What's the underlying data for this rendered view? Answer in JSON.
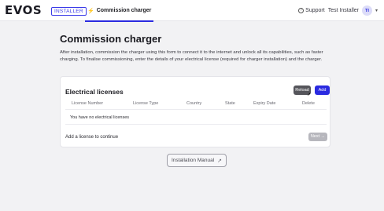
{
  "header": {
    "logo": "EVOS",
    "badge": "INSTALLER",
    "tab_icon": "⚡",
    "tab_label": "Commission charger",
    "support_label": "Support",
    "user_name": "Test Installer",
    "avatar_initials": "TI"
  },
  "main": {
    "title": "Commission charger",
    "description": "After installation, commission the charger using this form to connect it to the internet and unlock all its capabilities, such as faster charging. To finalise commissioning, enter the details of your electrical license (required for charger installation) and the charger."
  },
  "licenses": {
    "title": "Electrical licenses",
    "reload_label": "Reload",
    "add_label": "Add",
    "columns": [
      "License Number",
      "License Type",
      "Country",
      "State",
      "Expiry Date",
      "Delete"
    ],
    "empty_message": "You have no electrical licenses",
    "footer_message": "Add a license to continue",
    "next_label": "Next →"
  },
  "manual": {
    "label": "Installation Manual",
    "icon": "external-link-icon"
  },
  "colors": {
    "accent": "#2a2ae0",
    "reload_bg": "#55555b",
    "next_disabled": "#b7b7bd",
    "background": "#f2f2f4"
  }
}
